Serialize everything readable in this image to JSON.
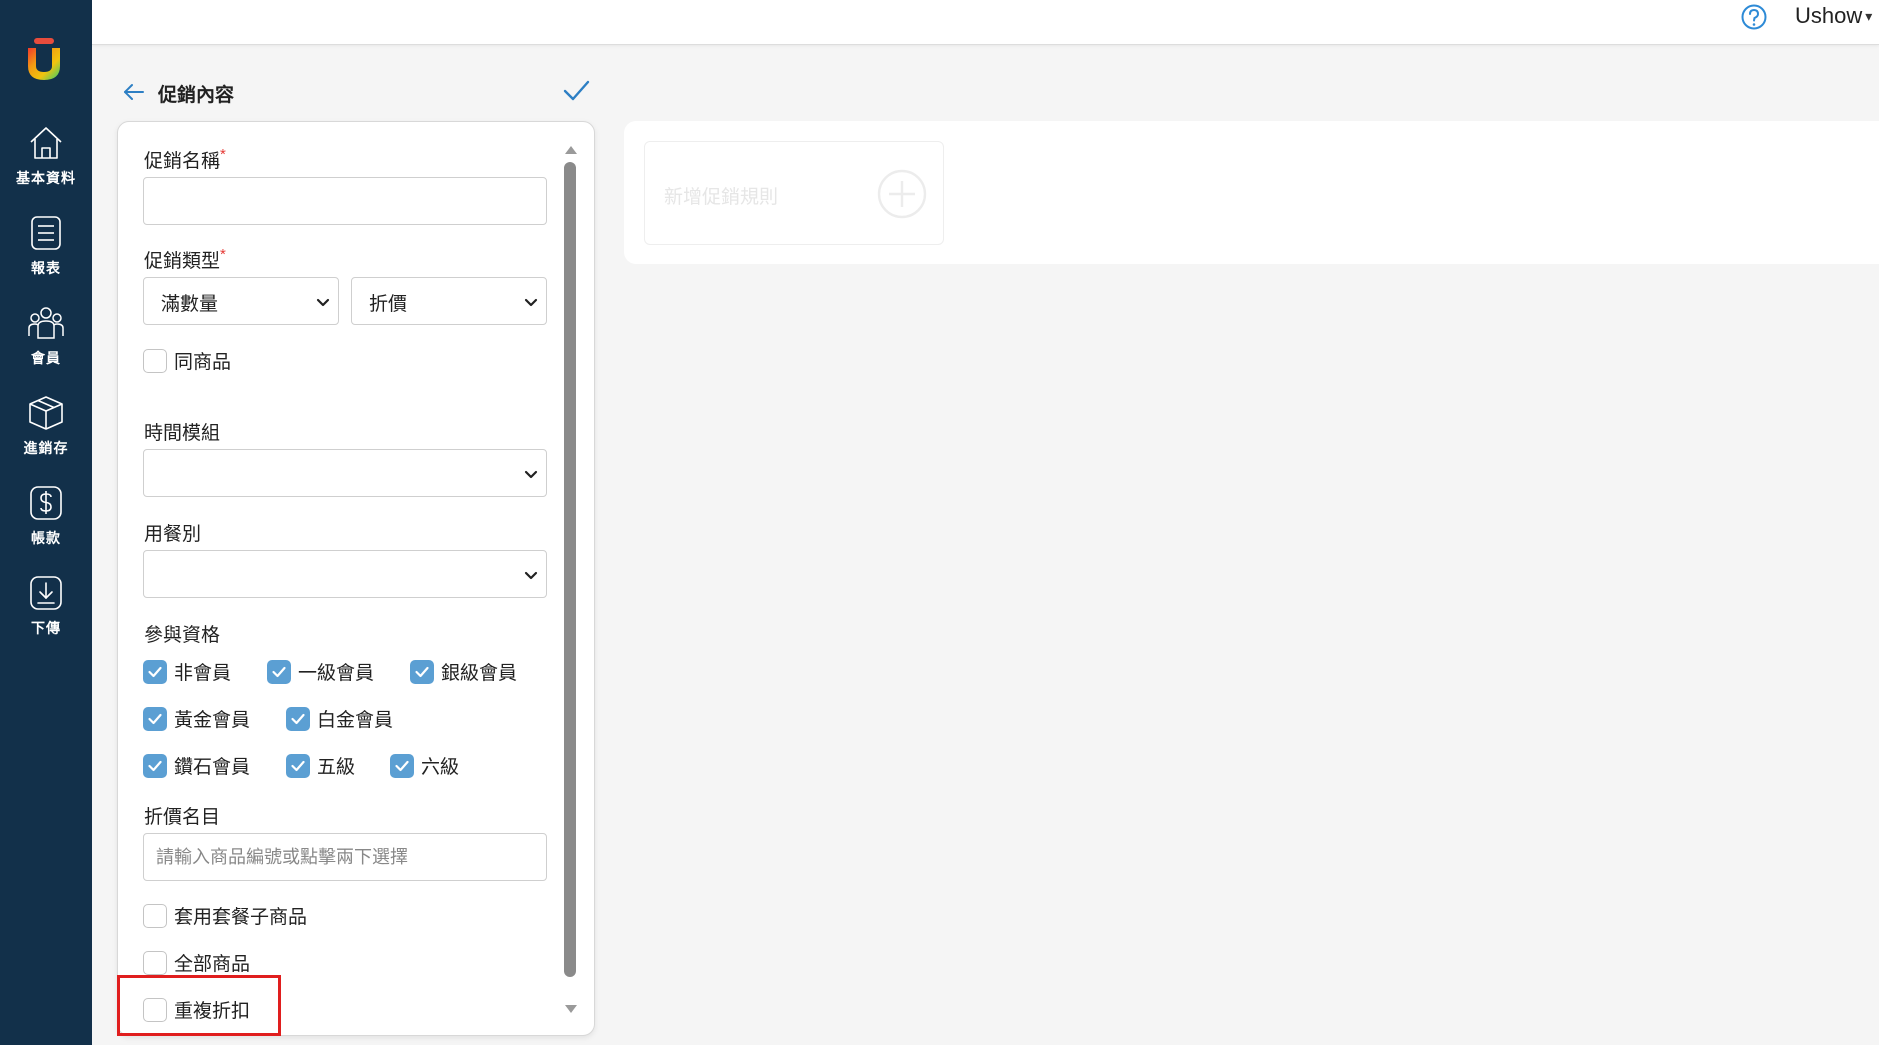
{
  "sidebar": {
    "items": [
      {
        "label": "基本資料",
        "icon": "home-icon"
      },
      {
        "label": "報表",
        "icon": "report-icon"
      },
      {
        "label": "會員",
        "icon": "members-icon"
      },
      {
        "label": "進銷存",
        "icon": "inventory-box-icon"
      },
      {
        "label": "帳款",
        "icon": "dollar-icon"
      },
      {
        "label": "下傳",
        "icon": "download-icon"
      }
    ]
  },
  "topbar": {
    "user_name": "Ushow",
    "caret": "▾",
    "help_icon": "help-icon"
  },
  "header": {
    "title": "促銷內容"
  },
  "form": {
    "promo_name_label": "促銷名稱",
    "required_mark": "*",
    "promo_name_value": "",
    "promo_type_label": "促銷類型",
    "promo_type_value": "滿數量",
    "promo_method_value": "折價",
    "same_product_label": "同商品",
    "same_product_checked": false,
    "time_module_label": "時間模組",
    "time_module_value": "",
    "meal_type_label": "用餐別",
    "meal_type_value": "",
    "eligibility_label": "參與資格",
    "eligibility": [
      {
        "label": "非會員",
        "checked": true
      },
      {
        "label": "一級會員",
        "checked": true
      },
      {
        "label": "銀級會員",
        "checked": true
      },
      {
        "label": "黃金會員",
        "checked": true
      },
      {
        "label": "白金會員",
        "checked": true
      },
      {
        "label": "鑽石會員",
        "checked": true
      },
      {
        "label": "五級",
        "checked": true
      },
      {
        "label": "六級",
        "checked": true
      }
    ],
    "discount_item_label": "折價名目",
    "discount_item_placeholder": "請輸入商品編號或點擊兩下選擇",
    "apply_combo_label": "套用套餐子商品",
    "all_products_label": "全部商品",
    "repeat_discount_label": "重複折扣"
  },
  "rules": {
    "add_rule_label": "新增促銷規則"
  },
  "colors": {
    "sidebar_bg": "#12304a",
    "accent": "#5b9fd3",
    "highlight": "#e01e1e"
  }
}
